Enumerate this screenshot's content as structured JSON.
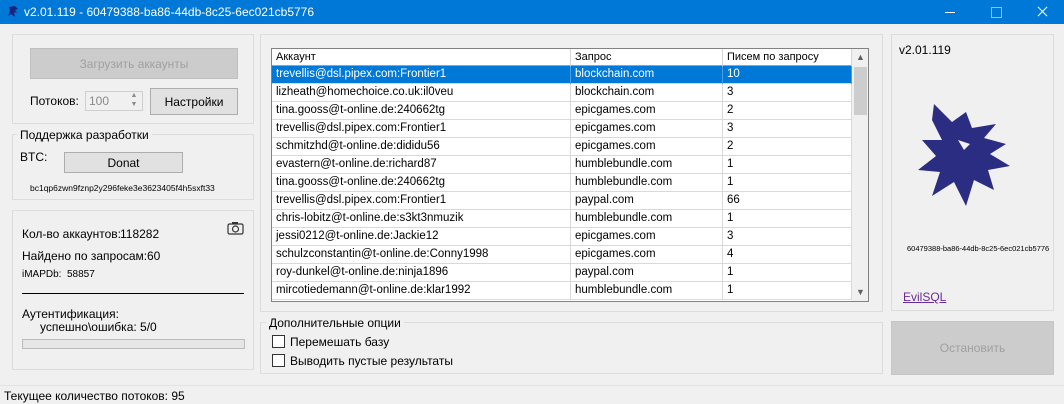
{
  "window": {
    "title": "v2.01.119 - 60479388-ba86-44db-8c25-6ec021cb5776"
  },
  "left": {
    "load_button": "Загрузить аккаунты",
    "threads_label": "Потоков:",
    "threads_value": "100",
    "settings_button": "Настройки",
    "support_group": "Поддержка разработки",
    "btc_label": "BTC:",
    "donate_button": "Donat",
    "btc_address": "bc1qp6zwn9fznp2y296feke3e3623405f4h5sxft33",
    "accounts_label": "Кол-во аккаунтов:",
    "accounts_value": "118282",
    "found_label": "Найдено по запросам:",
    "found_value": "60",
    "imapdb_label": "iMAPDb:",
    "imapdb_value": "58857",
    "auth_label": "Аутентификация:",
    "auth_detail": "успешно\\ошибка:  5/0",
    "auth_progress": 0
  },
  "grid": {
    "headers": [
      "Аккаунт",
      "Запрос",
      "Писем по запросу"
    ],
    "rows": [
      {
        "account": "trevellis@dsl.pipex.com:Frontier1",
        "query": "blockchain.com",
        "count": "10"
      },
      {
        "account": "lizheath@homechoice.co.uk:il0veu",
        "query": "blockchain.com",
        "count": "3"
      },
      {
        "account": "tina.gooss@t-online.de:240662tg",
        "query": "epicgames.com",
        "count": "2"
      },
      {
        "account": "trevellis@dsl.pipex.com:Frontier1",
        "query": "epicgames.com",
        "count": "3"
      },
      {
        "account": "schmitzhd@t-online.de:dididu56",
        "query": "epicgames.com",
        "count": "2"
      },
      {
        "account": "evastern@t-online.de:richard87",
        "query": "humblebundle.com",
        "count": "1"
      },
      {
        "account": "tina.gooss@t-online.de:240662tg",
        "query": "humblebundle.com",
        "count": "1"
      },
      {
        "account": "trevellis@dsl.pipex.com:Frontier1",
        "query": "paypal.com",
        "count": "66"
      },
      {
        "account": "chris-lobitz@t-online.de:s3kt3nmuzik",
        "query": "humblebundle.com",
        "count": "1"
      },
      {
        "account": "jessi0212@t-online.de:Jackie12",
        "query": "epicgames.com",
        "count": "3"
      },
      {
        "account": "schulzconstantin@t-online.de:Conny1998",
        "query": "epicgames.com",
        "count": "4"
      },
      {
        "account": "roy-dunkel@t-online.de:ninja1896",
        "query": "paypal.com",
        "count": "1"
      },
      {
        "account": "mircotiedemann@t-online.de:klar1992",
        "query": "humblebundle.com",
        "count": "1"
      }
    ],
    "selected_row": 0
  },
  "options": {
    "group": "Дополнительные опции",
    "shuffle_label": "Перемешать базу",
    "shuffle_checked": false,
    "empty_label": "Выводить пустые результаты",
    "empty_checked": false
  },
  "right": {
    "version": "v2.01.119",
    "guid": "60479388-ba86-44db-8c25-6ec021cb5776",
    "link": "EvilSQL",
    "stop_button": "Остановить",
    "logo_color": "#2b2d83"
  },
  "status": {
    "text": "Текущее количество потоков: 95"
  },
  "colors": {
    "titlebar": "#0078d7",
    "selection": "#0078d7"
  }
}
